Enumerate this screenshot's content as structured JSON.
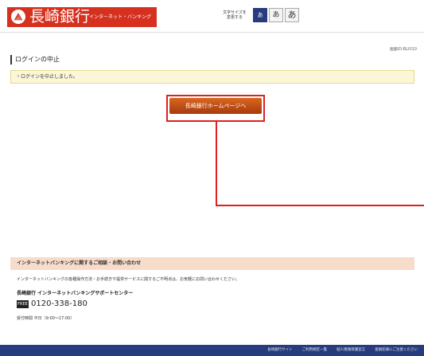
{
  "header": {
    "logo_mark": "⟁",
    "bank_name": "長崎銀行",
    "service_name": "インターネット・バンキング",
    "fontsize_label": "文字サイズを変更する",
    "fontsize_buttons": [
      "あ",
      "あ",
      "あ"
    ],
    "screen_id": "画面ID:BLI010"
  },
  "main": {
    "page_title": "ログインの中止",
    "message": "・ログインを中止しました。",
    "home_button": "長崎銀行ホームページへ"
  },
  "contact": {
    "heading": "インターネットバンキングに関するご相談・お問い合わせ",
    "text": "インターネットバンキングの各種操作方法・お手続きや提供サービスに関するご不明点は、お気軽にお問い合わせください。",
    "center_name": "長崎銀行 インターネットバンキングサポートセンター",
    "free_dial_icon": "FREE",
    "phone": "0120-338-180",
    "hours": "受付時間 平日（9:00～17:00）"
  },
  "footer": {
    "links": [
      "長崎銀行サイト",
      "ご利用規定一覧",
      "個人情報保護宣言",
      "金融犯罪にご注意ください"
    ]
  },
  "colors": {
    "brand_red": "#d6301f",
    "footer_navy": "#273c7c",
    "annotation_red": "#e02020"
  }
}
